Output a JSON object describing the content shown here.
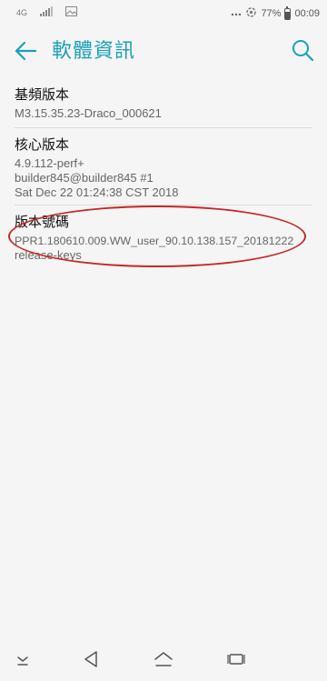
{
  "status_bar": {
    "network_type": "4G",
    "battery_percent": "77%",
    "time": "00:09",
    "icons": [
      "network-4g-icon",
      "signal-icon",
      "image-notification-icon",
      "more-icon",
      "sync-icon",
      "battery-icon"
    ]
  },
  "header": {
    "title": "軟體資訊",
    "back_icon": "arrow-left-icon",
    "search_icon": "search-icon"
  },
  "items": [
    {
      "title": "基頻版本",
      "lines": [
        "M3.15.35.23-Draco_000621"
      ]
    },
    {
      "title": "核心版本",
      "lines": [
        "4.9.112-perf+",
        "builder845@builder845 #1",
        "Sat Dec 22 01:24:38 CST 2018"
      ]
    },
    {
      "title": "版本號碼",
      "lines": [
        "PPR1.180610.009.WW_user_90.10.138.157_20181222",
        "release-keys"
      ]
    }
  ],
  "nav_bar": {
    "icons": [
      "collapse-down-icon",
      "back-triangle-icon",
      "home-icon",
      "recents-icon"
    ]
  },
  "colors": {
    "accent": "#1aa0b8",
    "highlight": "#c62828",
    "background": "#f5f5f5"
  }
}
